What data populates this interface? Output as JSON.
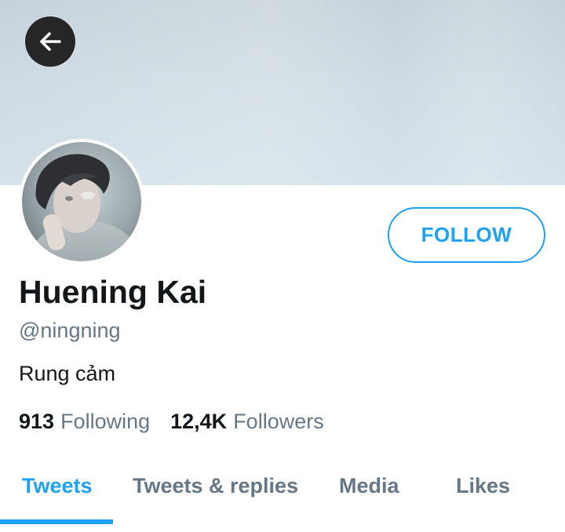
{
  "profile": {
    "display_name": "Huening Kai",
    "handle": "@ningning",
    "bio": "Rung cảm",
    "avatar_icon": "profile-photo"
  },
  "header": {
    "back_icon": "arrow-left-icon"
  },
  "actions": {
    "follow_label": "FOLLOW"
  },
  "stats": {
    "following_count": "913",
    "following_label": "Following",
    "followers_count": "12,4K",
    "followers_label": "Followers"
  },
  "tabs": [
    {
      "label": "Tweets",
      "active": true
    },
    {
      "label": "Tweets & replies",
      "active": false
    },
    {
      "label": "Media",
      "active": false
    },
    {
      "label": "Likes",
      "active": false
    }
  ],
  "colors": {
    "accent": "#1da1f2",
    "secondary_text": "#657786",
    "primary_text": "#14171a"
  }
}
